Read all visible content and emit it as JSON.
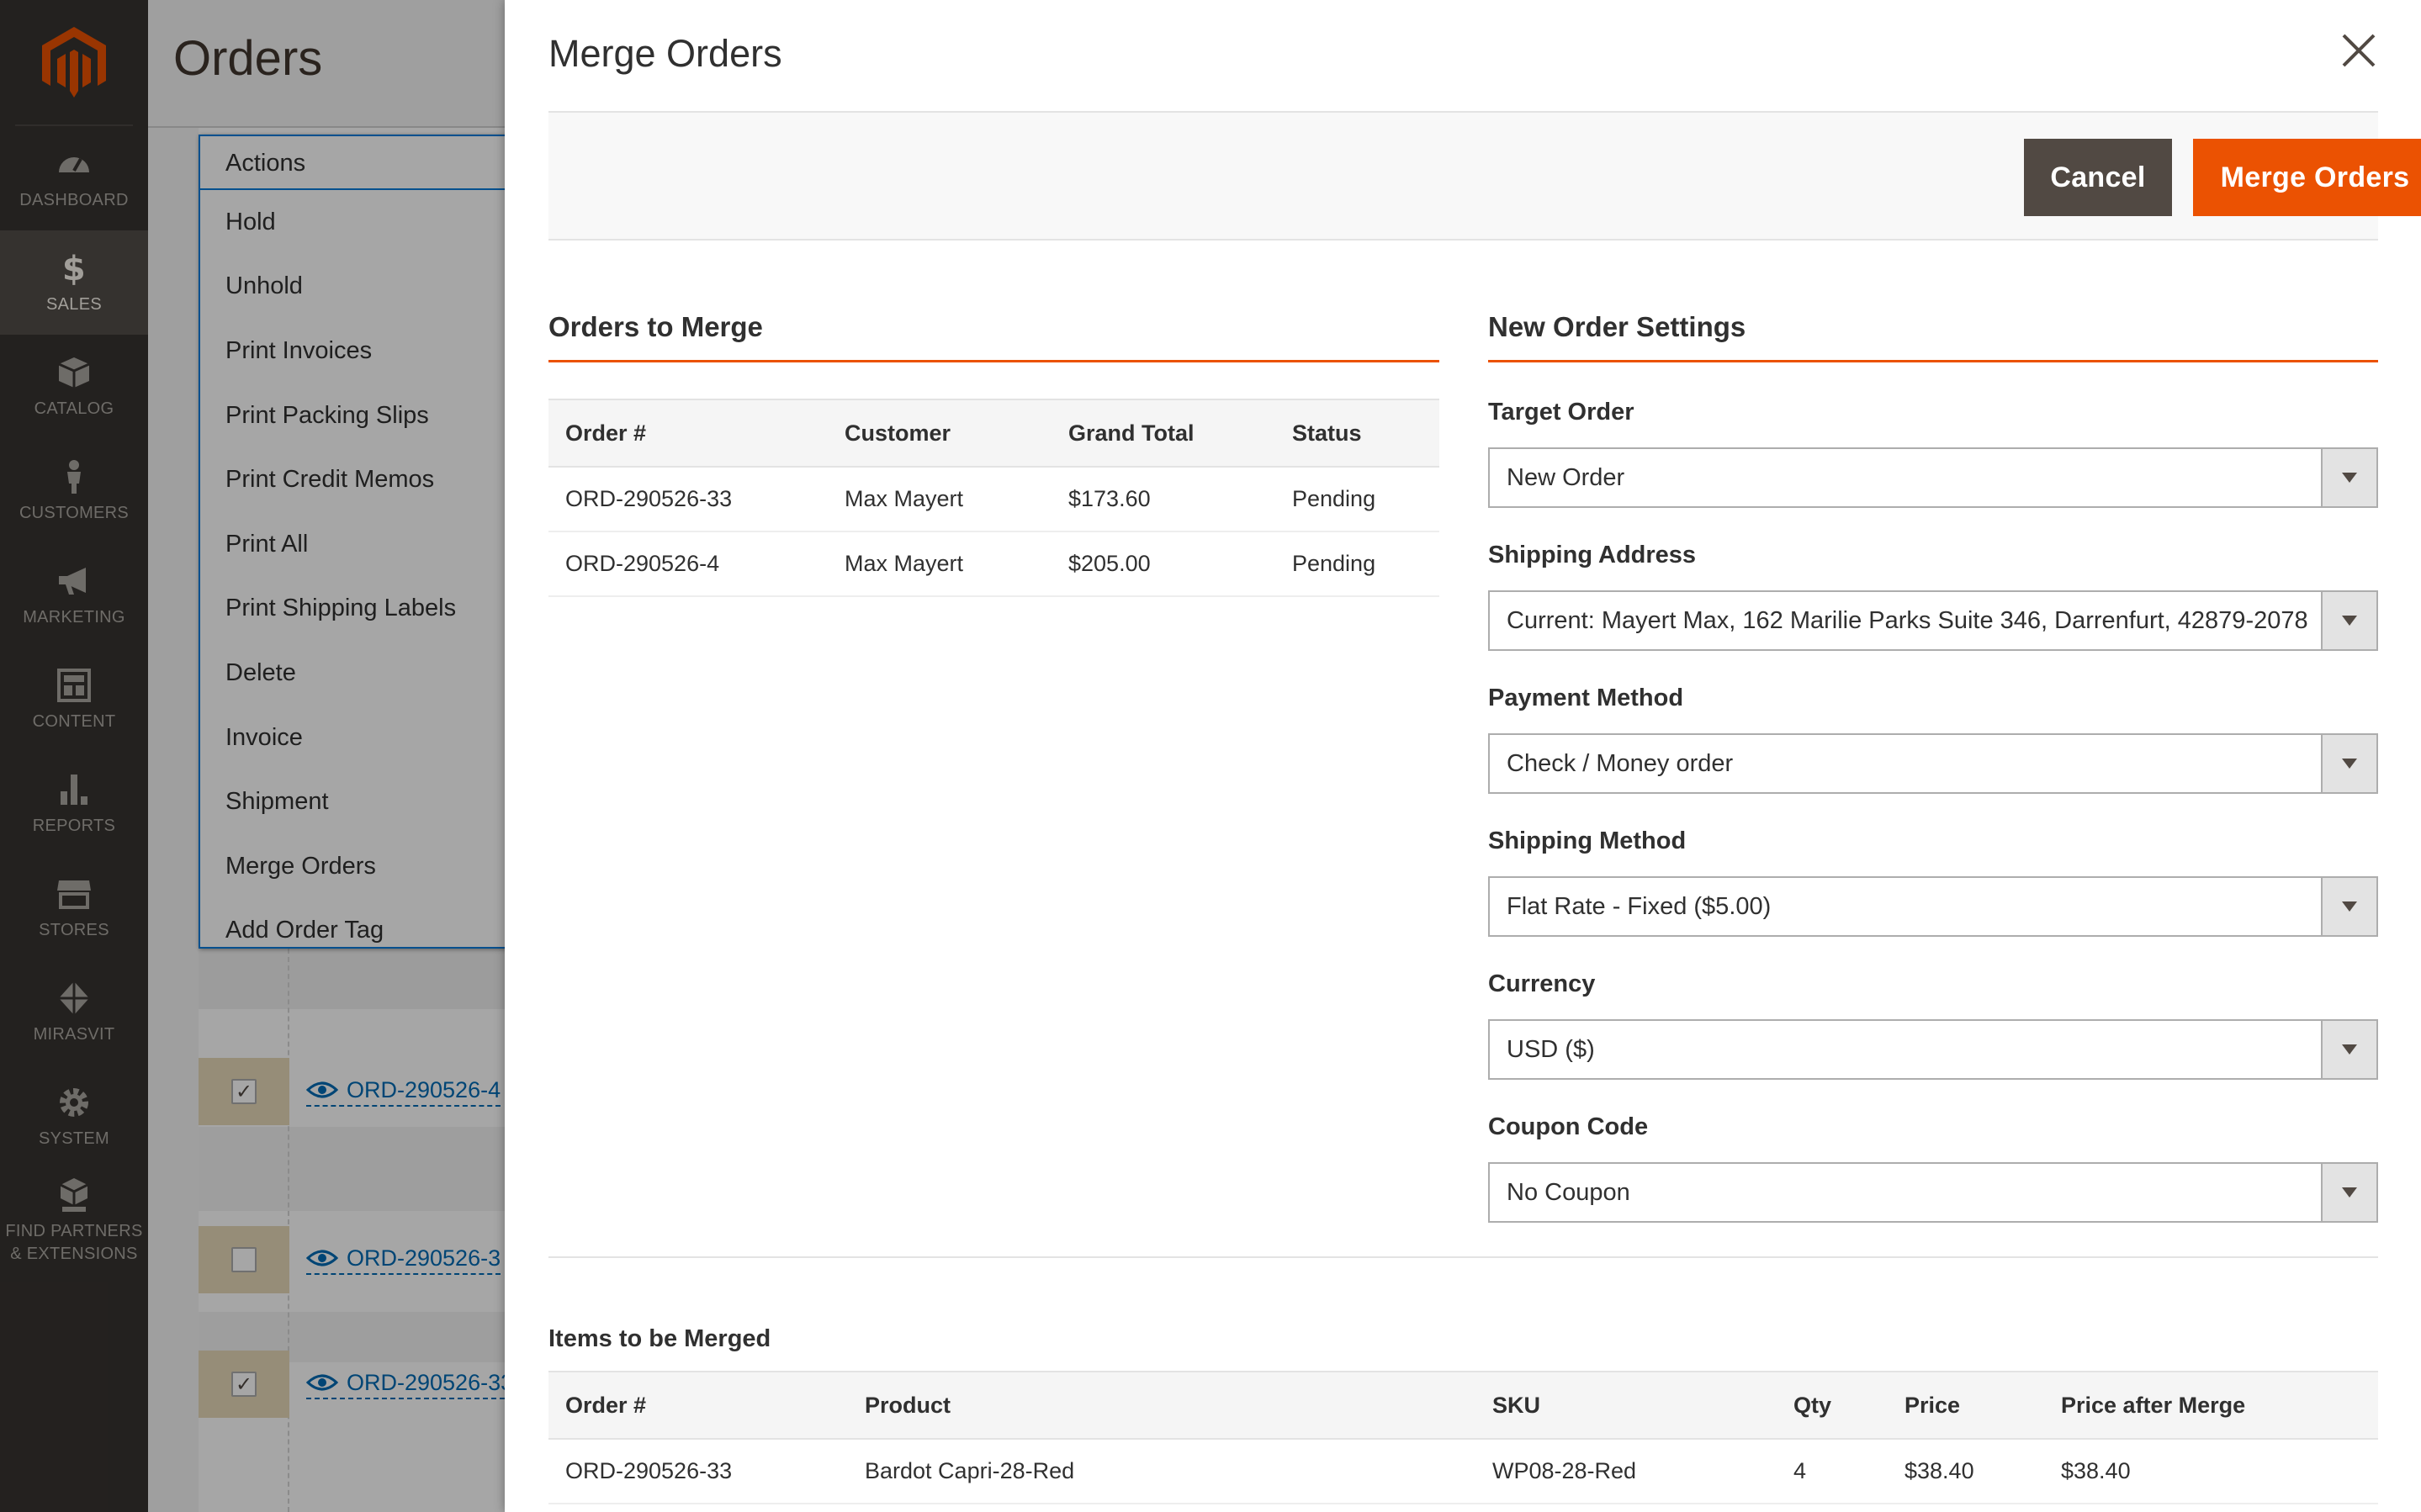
{
  "admin_menu": {
    "items": [
      {
        "label": "Dashboard",
        "icon": "dashboard-icon"
      },
      {
        "label": "Sales",
        "icon": "dollar-icon"
      },
      {
        "label": "Catalog",
        "icon": "box-icon"
      },
      {
        "label": "Customers",
        "icon": "person-icon"
      },
      {
        "label": "Marketing",
        "icon": "megaphone-icon"
      },
      {
        "label": "Content",
        "icon": "layout-icon"
      },
      {
        "label": "Reports",
        "icon": "bar-chart-icon"
      },
      {
        "label": "Stores",
        "icon": "storefront-icon"
      },
      {
        "label": "Mirasvit",
        "icon": "diamond-icon"
      },
      {
        "label": "System",
        "icon": "gear-icon"
      },
      {
        "label": "Find Partners & Extensions",
        "icon": "cubes-icon"
      }
    ],
    "active": "Sales"
  },
  "page": {
    "title": "Orders",
    "actions_label": "Actions",
    "actions": [
      "Hold",
      "Unhold",
      "Print Invoices",
      "Print Packing Slips",
      "Print Credit Memos",
      "Print All",
      "Print Shipping Labels",
      "Delete",
      "Invoice",
      "Shipment",
      "Merge Orders",
      "Add Order Tag"
    ],
    "grid_rows": [
      {
        "order": "ORD-290526-4",
        "checked": true
      },
      {
        "order": "ORD-290526-3",
        "checked": false
      },
      {
        "order": "ORD-290526-33",
        "checked": true
      }
    ]
  },
  "modal": {
    "title": "Merge Orders",
    "cancel_label": "Cancel",
    "merge_label": "Merge Orders",
    "orders_section": {
      "title": "Orders to Merge",
      "columns": [
        "Order #",
        "Customer",
        "Grand Total",
        "Status"
      ],
      "rows": [
        [
          "ORD-290526-33",
          "Max Mayert",
          "$173.60",
          "Pending"
        ],
        [
          "ORD-290526-4",
          "Max Mayert",
          "$205.00",
          "Pending"
        ]
      ]
    },
    "settings_section": {
      "title": "New Order Settings",
      "fields": {
        "target_order": {
          "label": "Target Order",
          "value": "New Order"
        },
        "shipping_address": {
          "label": "Shipping Address",
          "value": "Current: Mayert Max, 162 Marilie Parks Suite 346, Darrenfurt, 42879-2078"
        },
        "payment_method": {
          "label": "Payment Method",
          "value": "Check / Money order"
        },
        "shipping_method": {
          "label": "Shipping Method",
          "value": "Flat Rate - Fixed ($5.00)"
        },
        "currency": {
          "label": "Currency",
          "value": "USD ($)"
        },
        "coupon_code": {
          "label": "Coupon Code",
          "value": "No Coupon"
        }
      }
    },
    "items_section": {
      "title": "Items to be Merged",
      "columns": [
        "Order #",
        "Product",
        "SKU",
        "Qty",
        "Price",
        "Price after Merge"
      ],
      "rows": [
        [
          "ORD-290526-33",
          "Bardot Capri-28-Red",
          "WP08-28-Red",
          "4",
          "$38.40",
          "$38.40"
        ]
      ]
    }
  },
  "colors": {
    "accent": "#eb5202",
    "menu_bg": "#373330",
    "cancel_bg": "#514943",
    "link": "#006bb4"
  }
}
